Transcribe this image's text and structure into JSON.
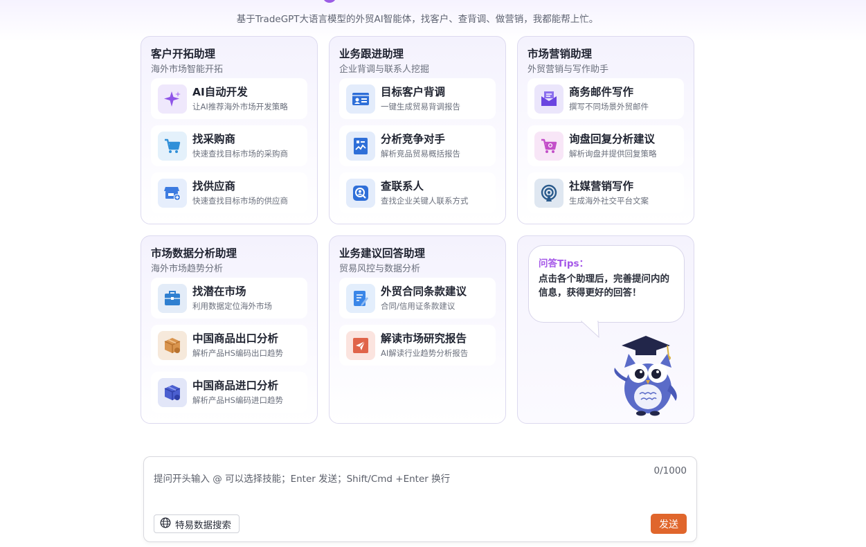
{
  "header": {
    "subtitle": "基于TradeGPT大语言模型的外贸AI智能体，找客户、查背调、做营销，我都能帮上忙。"
  },
  "cards": [
    {
      "title": "客户开拓助理",
      "subtitle": "海外市场智能开拓",
      "items": [
        {
          "title": "AI自动开发",
          "desc": "让AI推荐海外市场开发策略",
          "icon": "sparkle-icon",
          "color": "#8f55e8"
        },
        {
          "title": "找采购商",
          "desc": "快速查找目标市场的采购商",
          "icon": "shopping-cart-icon",
          "color": "#2f8fd8"
        },
        {
          "title": "找供应商",
          "desc": "快速查找目标市场的供应商",
          "icon": "store-add-icon",
          "color": "#3d7be0"
        }
      ]
    },
    {
      "title": "业务跟进助理",
      "subtitle": "企业背调与联系人挖掘",
      "items": [
        {
          "title": "目标客户背调",
          "desc": "一键生成贸易背调报告",
          "icon": "id-card-icon",
          "color": "#2f6fd8"
        },
        {
          "title": "分析竞争对手",
          "desc": "解析竞品贸易概括报告",
          "icon": "report-chart-icon",
          "color": "#2f6fd8"
        },
        {
          "title": "查联系人",
          "desc": "查找企业关键人联系方式",
          "icon": "contact-search-icon",
          "color": "#2f6fd8"
        }
      ]
    },
    {
      "title": "市场营销助理",
      "subtitle": "外贸营销与写作助手",
      "items": [
        {
          "title": "商务邮件写作",
          "desc": "撰写不同场景外贸邮件",
          "icon": "mail-icon",
          "color": "#6a45e0"
        },
        {
          "title": "询盘回复分析建议",
          "desc": "解析询盘并提供回复策略",
          "icon": "cart-search-icon",
          "color": "#c34fc9"
        },
        {
          "title": "社媒营销写作",
          "desc": "生成海外社交平台文案",
          "icon": "broadcast-icon",
          "color": "#2a5a8c"
        }
      ]
    },
    {
      "title": "市场数据分析助理",
      "subtitle": "海外市场趋势分析",
      "items": [
        {
          "title": "找潜在市场",
          "desc": "利用数据定位海外市场",
          "icon": "briefcase-icon",
          "color": "#2f7fd0"
        },
        {
          "title": "中国商品出口分析",
          "desc": "解析产品HS编码出口趋势",
          "icon": "box-export-icon",
          "color": "#d9944d"
        },
        {
          "title": "中国商品进口分析",
          "desc": "解析产品HS编码进口趋势",
          "icon": "box-import-icon",
          "color": "#4b5fd0"
        }
      ]
    },
    {
      "title": "业务建议回答助理",
      "subtitle": "贸易风控与数据分析",
      "items": [
        {
          "title": "外贸合同条款建议",
          "desc": "合同/信用证条款建议",
          "icon": "contract-edit-icon",
          "color": "#3a86e8"
        },
        {
          "title": "解读市场研究报告",
          "desc": "AI解读行业趋势分析报告",
          "icon": "send-report-icon",
          "color": "#e0644a"
        }
      ]
    }
  ],
  "tips": {
    "title": "问答Tips：",
    "text": "点击各个助理后，完善提问内的信息，获得更好的回答！"
  },
  "input": {
    "placeholder": "提问开头输入 @ 可以选择技能；Enter 发送；Shift/Cmd +Enter 换行",
    "counter": "0/1000",
    "search_chip": "特易数据搜索",
    "send_label": "发送"
  },
  "colors": {
    "accent_purple": "#9b5de5",
    "send_button": "#e0662c",
    "card_border": "#dcd9ef"
  }
}
